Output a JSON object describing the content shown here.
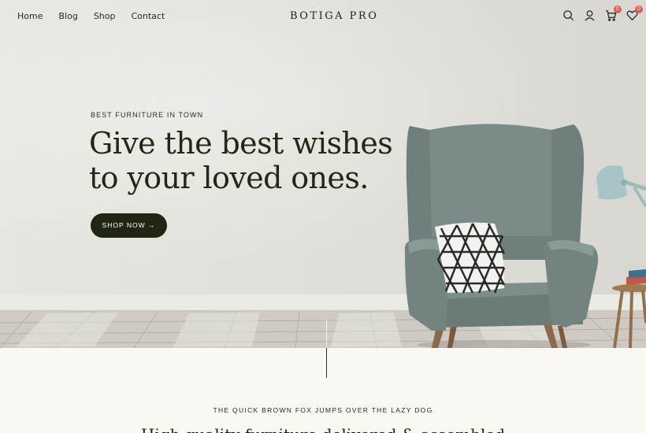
{
  "nav": {
    "menu": [
      "Home",
      "Blog",
      "Shop",
      "Contact"
    ],
    "logo": "BOTIGA PRO",
    "icons": [
      "search-icon",
      "user-icon",
      "cart-icon",
      "heart-icon"
    ],
    "cart_count": "0",
    "wishlist_count": "0"
  },
  "hero": {
    "eyebrow": "BEST FURNITURE IN TOWN",
    "headline": "Give the best wishes to your loved ones.",
    "cta_label": "SHOP NOW →"
  },
  "section": {
    "eyebrow": "THE QUICK BROWN FOX JUMPS OVER THE LAZY DOG",
    "title": "High quality furniture delivered & assembled"
  },
  "colors": {
    "primary": "#1f2713",
    "badge": "#e85a50",
    "background": "#faf8f3"
  }
}
